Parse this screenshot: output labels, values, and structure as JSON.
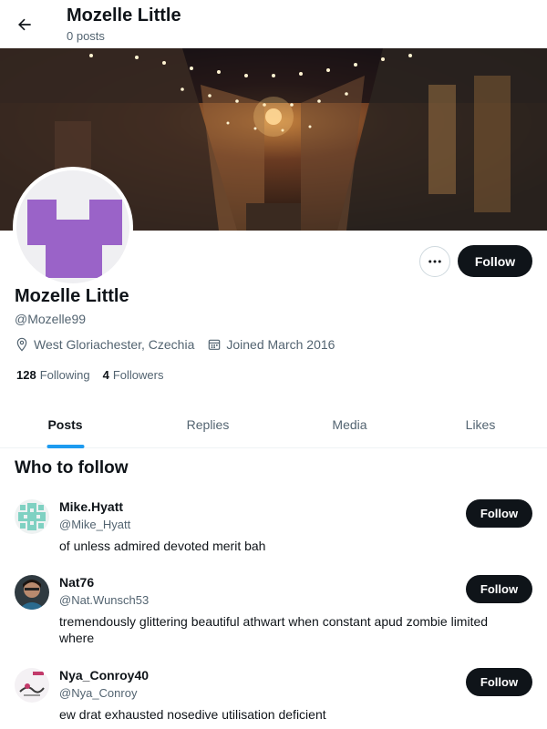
{
  "header": {
    "title": "Mozelle Little",
    "subtitle": "0 posts"
  },
  "profile": {
    "display_name": "Mozelle Little",
    "handle": "@Mozelle99",
    "location": "West Gloriachester, Czechia",
    "joined": "Joined March 2016",
    "following_count": "128",
    "following_label": "Following",
    "followers_count": "4",
    "followers_label": "Followers",
    "follow_label": "Follow",
    "avatar_color": "#9a63c8"
  },
  "tabs": [
    {
      "label": "Posts",
      "active": true
    },
    {
      "label": "Replies",
      "active": false
    },
    {
      "label": "Media",
      "active": false
    },
    {
      "label": "Likes",
      "active": false
    }
  ],
  "who_to_follow": {
    "title": "Who to follow",
    "users": [
      {
        "name": "Mike.Hyatt",
        "handle": "@Mike_Hyatt",
        "bio": "of unless admired devoted merit bah",
        "follow_label": "Follow"
      },
      {
        "name": "Nat76",
        "handle": "@Nat.Wunsch53",
        "bio": "tremendously glittering beautiful athwart when constant apud zombie limited where",
        "follow_label": "Follow"
      },
      {
        "name": "Nya_Conroy40",
        "handle": "@Nya_Conroy",
        "bio": "ew drat exhausted nosedive utilisation deficient",
        "follow_label": "Follow"
      }
    ]
  },
  "colors": {
    "accent": "#1d9bf0",
    "button_dark": "#0f1419",
    "secondary_text": "#536471"
  }
}
